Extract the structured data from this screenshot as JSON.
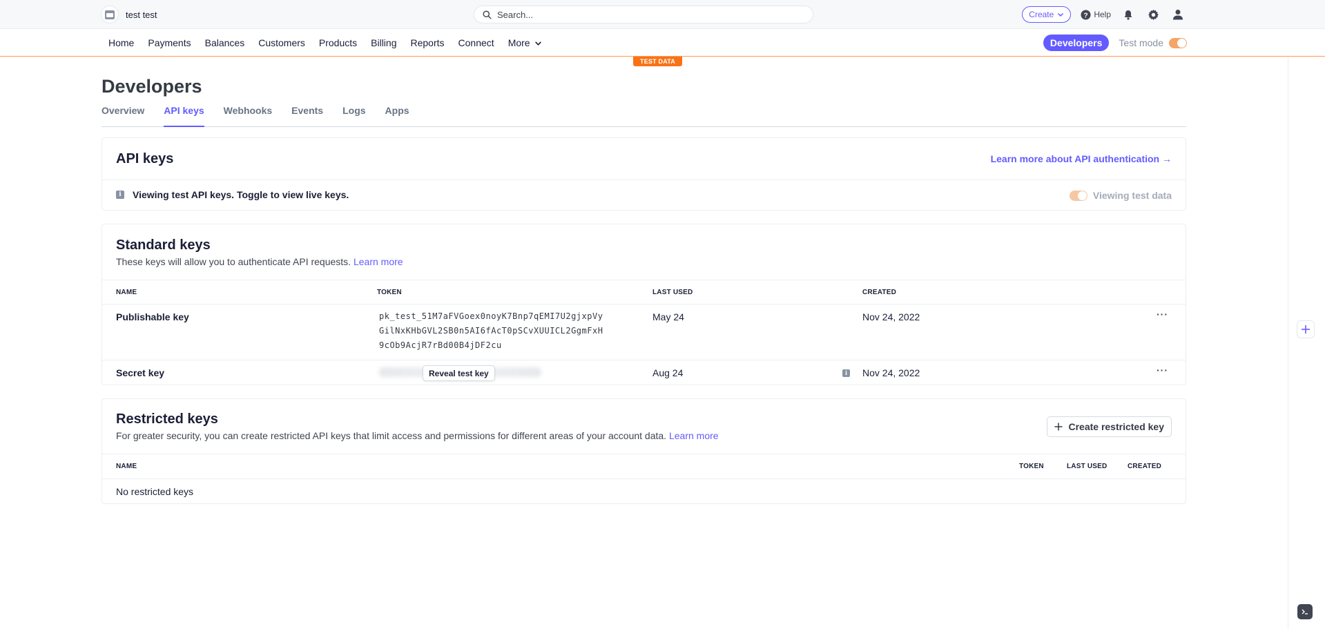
{
  "topbar": {
    "account_name": "test test",
    "search_placeholder": "Search...",
    "create_label": "Create",
    "help_label": "Help"
  },
  "nav": {
    "items": [
      "Home",
      "Payments",
      "Balances",
      "Customers",
      "Products",
      "Billing",
      "Reports",
      "Connect",
      "More"
    ],
    "developers_label": "Developers",
    "test_mode_label": "Test mode",
    "test_mode_on": true,
    "test_data_badge": "TEST DATA"
  },
  "page": {
    "title": "Developers",
    "tabs": [
      "Overview",
      "API keys",
      "Webhooks",
      "Events",
      "Logs",
      "Apps"
    ],
    "active_tab": "API keys"
  },
  "api_keys_card": {
    "title": "API keys",
    "learn_more_link": "Learn more about API authentication →",
    "info_text": "Viewing test API keys. Toggle to view live keys.",
    "viewing_test_label": "Viewing test data"
  },
  "standard_keys": {
    "title": "Standard keys",
    "subtitle": "These keys will allow you to authenticate API requests.",
    "learn_more": "Learn more",
    "columns": [
      "NAME",
      "TOKEN",
      "LAST USED",
      "CREATED"
    ],
    "rows": [
      {
        "name": "Publishable key",
        "token_lines": [
          "pk_test_51M7aFVGoex0noyK7Bnp7qEMI7U2gjxpVy",
          "GilNxKHbGVL2SB0n5AI6fAcT0pSCvXUUICL2GgmFxH",
          "9cOb9AcjR7rBd00B4jDF2cu"
        ],
        "last_used": "May 24",
        "created": "Nov 24, 2022"
      },
      {
        "name": "Secret key",
        "reveal_label": "Reveal test key",
        "last_used": "Aug 24",
        "created": "Nov 24, 2022"
      }
    ]
  },
  "restricted_keys": {
    "title": "Restricted keys",
    "subtitle": "For greater security, you can create restricted API keys that limit access and permissions for different areas of your account data.",
    "learn_more": "Learn more",
    "create_button": "Create restricted key",
    "columns": [
      "NAME",
      "TOKEN",
      "LAST USED",
      "CREATED"
    ],
    "empty_text": "No restricted keys"
  },
  "colors": {
    "accent": "#635bff",
    "test_mode_orange": "#f97316",
    "text_primary": "#1a1f36"
  },
  "icons": [
    "account-logo-icon",
    "search-icon",
    "chevron-down-icon",
    "help-icon",
    "bell-icon",
    "gear-icon",
    "user-icon",
    "info-icon",
    "more-dots-icon",
    "plus-icon",
    "terminal-icon"
  ]
}
